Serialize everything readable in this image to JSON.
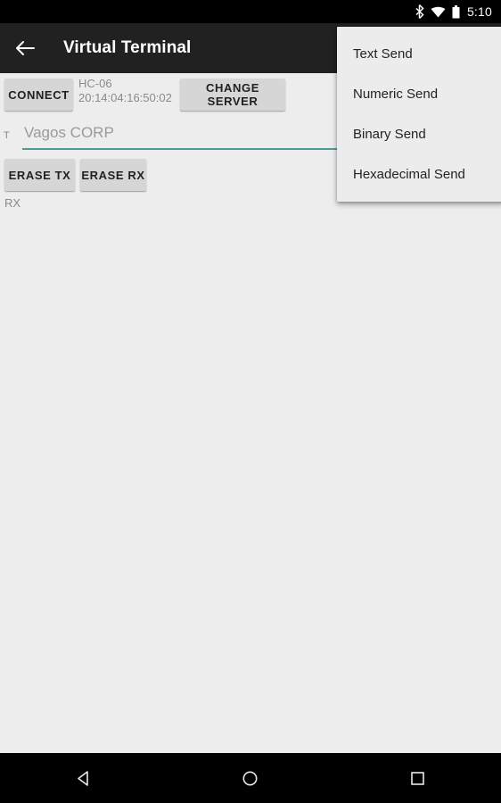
{
  "status_bar": {
    "bluetooth_icon": "bluetooth-icon",
    "wifi_icon": "wifi-icon",
    "battery_icon": "battery-icon",
    "time": "5:10"
  },
  "toolbar": {
    "back_icon": "back-arrow-icon",
    "title": "Virtual Terminal",
    "background": "#212121"
  },
  "connect_row": {
    "connect_label": "CONNECT",
    "device_name": "HC-06",
    "device_address": "20:14:04:16:50:02",
    "change_server_label": "CHANGE SERVER"
  },
  "tx_field": {
    "label": "T",
    "value": "",
    "placeholder": "Vagos CORP",
    "underline_color": "#4e9b96"
  },
  "erase_buttons": {
    "erase_tx_label": "ERASE TX",
    "erase_rx_label": "ERASE RX"
  },
  "rx_section": {
    "label": "RX",
    "content": ""
  },
  "overflow_menu": {
    "visible": true,
    "items": [
      {
        "label": "Text Send"
      },
      {
        "label": "Numeric Send"
      },
      {
        "label": "Binary Send"
      },
      {
        "label": "Hexadecimal Send"
      }
    ]
  },
  "nav_bar": {
    "back_icon": "nav-back-triangle-icon",
    "home_icon": "nav-home-circle-icon",
    "recents_icon": "nav-recents-square-icon"
  },
  "colors": {
    "accent": "#4e9b96",
    "toolbar_bg": "#212121",
    "page_bg": "#ededed",
    "button_bg": "#d6d6d6",
    "menu_bg": "#ececec",
    "muted_text": "#8a8a8a"
  }
}
